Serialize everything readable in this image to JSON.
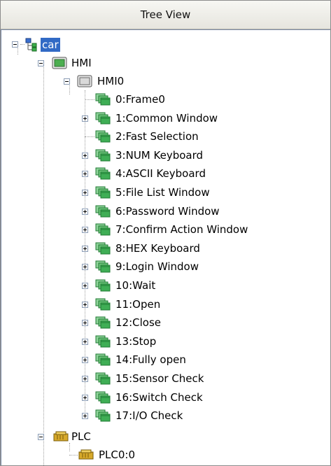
{
  "panel": {
    "title": "Tree View"
  },
  "root": {
    "label": "car",
    "icon": "project-tree-icon"
  },
  "hmi": {
    "label": "HMI",
    "icon": "hmi-monitor-icon"
  },
  "hmi0": {
    "label": "HMI0",
    "icon": "hmi-monitor-icon"
  },
  "windows": [
    {
      "label": "0:Frame0",
      "expandable": false
    },
    {
      "label": "1:Common Window",
      "expandable": true
    },
    {
      "label": "2:Fast Selection",
      "expandable": false
    },
    {
      "label": "3:NUM Keyboard",
      "expandable": true
    },
    {
      "label": "4:ASCII Keyboard",
      "expandable": true
    },
    {
      "label": "5:File List Window",
      "expandable": true
    },
    {
      "label": "6:Password Window",
      "expandable": true
    },
    {
      "label": "7:Confirm Action Window",
      "expandable": true
    },
    {
      "label": "8:HEX Keyboard",
      "expandable": true
    },
    {
      "label": "9:Login Window",
      "expandable": true
    },
    {
      "label": "10:Wait",
      "expandable": true
    },
    {
      "label": "11:Open",
      "expandable": true
    },
    {
      "label": "12:Close",
      "expandable": true
    },
    {
      "label": "13:Stop",
      "expandable": true
    },
    {
      "label": "14:Fully open",
      "expandable": true
    },
    {
      "label": "15:Sensor Check",
      "expandable": true
    },
    {
      "label": "16:Switch Check",
      "expandable": true
    },
    {
      "label": "17:I/O Check",
      "expandable": true
    }
  ],
  "plc": {
    "label": "PLC",
    "icon": "plc-module-icon"
  },
  "plc0": {
    "label": "PLC0:0",
    "icon": "plc-module-icon"
  },
  "colors": {
    "selection": "#316ac5",
    "window_icon": "#2fa24a",
    "plc_icon": "#c8a020"
  }
}
